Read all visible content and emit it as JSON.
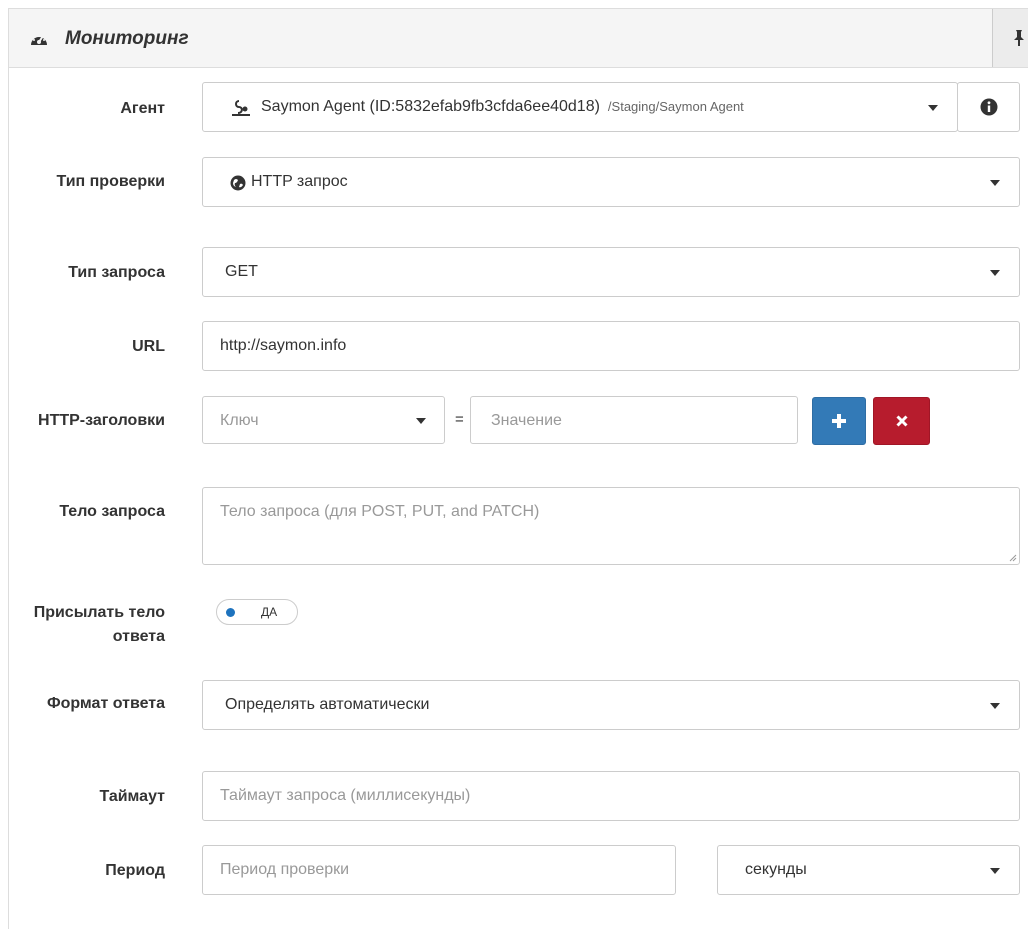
{
  "panel": {
    "title": "Мониторинг"
  },
  "form": {
    "agent": {
      "label": "Агент",
      "value": "Saymon Agent (ID:5832efab9fb3cfda6ee40d18)",
      "path": "/Staging/Saymon Agent"
    },
    "check_type": {
      "label": "Тип проверки",
      "value": "HTTP запрос"
    },
    "request_type": {
      "label": "Тип запроса",
      "value": "GET"
    },
    "url": {
      "label": "URL",
      "value": "http://saymon.info"
    },
    "headers": {
      "label": "HTTP-заголовки",
      "key_placeholder": "Ключ",
      "equals": "=",
      "value_placeholder": "Значение"
    },
    "body": {
      "label": "Тело запроса",
      "placeholder": "Тело запроса (для POST, PUT, and PATCH)"
    },
    "send_response_body": {
      "label": "Присылать тело ответа",
      "toggle_text": "ДА",
      "enabled": true
    },
    "response_format": {
      "label": "Формат ответа",
      "value": "Определять автоматически"
    },
    "timeout": {
      "label": "Таймаут",
      "placeholder": "Таймаут запроса (миллисекунды)"
    },
    "period": {
      "label": "Период",
      "placeholder": "Период проверки",
      "unit": "секунды"
    }
  },
  "colors": {
    "add_button": "#337ab7",
    "remove_button": "#b71c2d",
    "toggle_dot": "#1e73be"
  }
}
